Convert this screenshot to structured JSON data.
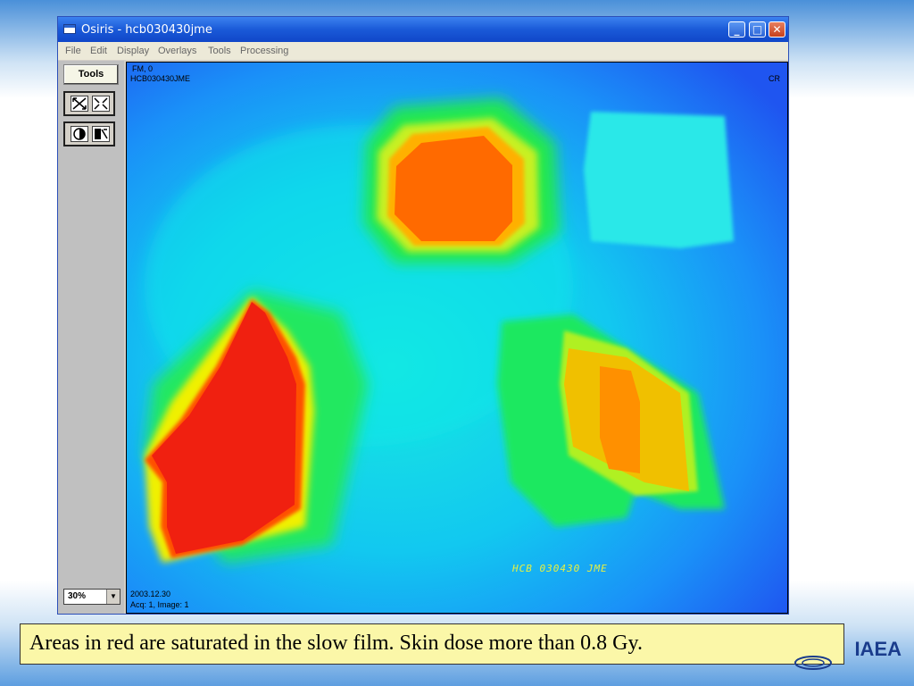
{
  "window": {
    "title": "Osiris - hcb030430jme",
    "buttons": {
      "minimize": "_",
      "maximize": "□",
      "close": "✕"
    }
  },
  "menubar": {
    "items": [
      "File",
      "Edit",
      "Display",
      "Overlays",
      "Tools",
      "Processing"
    ]
  },
  "toolpanel": {
    "tools_label": "Tools",
    "zoom": "30%",
    "icons": [
      "fit-icon",
      "shrink-icon",
      "contrast-icon",
      "invert-icon"
    ]
  },
  "image": {
    "top_left_line1": "FM, 0",
    "top_left_line2": "HCB030430JME",
    "top_right": "CR",
    "bottom_left_line1": "2003.12.30",
    "bottom_left_line2": "Acq: 1, Image: 1",
    "film_annotation": "HCB 030430 JME"
  },
  "caption": "Areas in red are saturated in the slow film. Skin dose more than 0.8 Gy.",
  "logo": "IAEA"
}
